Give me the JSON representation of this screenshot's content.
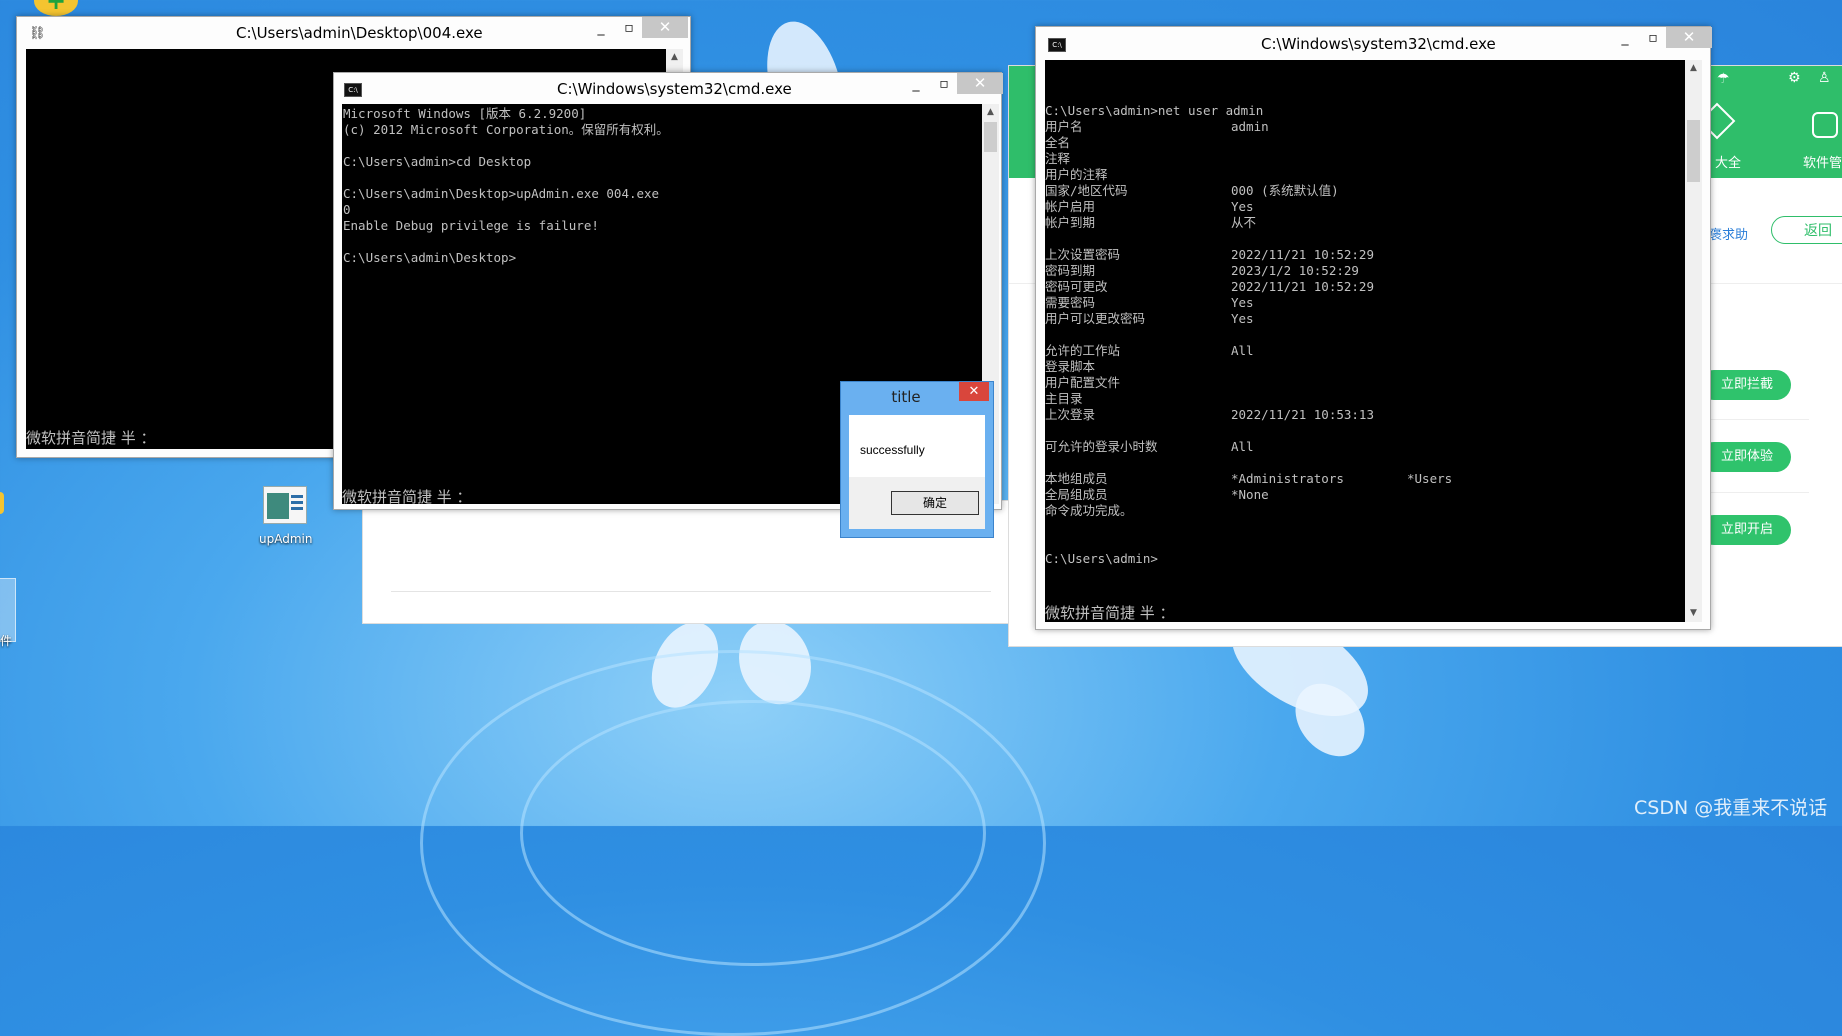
{
  "desktop": {
    "icon_label": "upAdmin",
    "left_edge_label": "件",
    "watermark": "CSDN @我重来不说话"
  },
  "win_004": {
    "title": "C:\\Users\\admin\\Desktop\\004.exe",
    "ime": "微软拼音简捷 半 ："
  },
  "cmd_middle": {
    "title": "C:\\Windows\\system32\\cmd.exe",
    "lines": [
      "Microsoft Windows [版本 6.2.9200]",
      "(c) 2012 Microsoft Corporation。保留所有权利。",
      "",
      "C:\\Users\\admin>cd Desktop",
      "",
      "C:\\Users\\admin\\Desktop>upAdmin.exe 004.exe",
      "0",
      "Enable Debug privilege is failure!",
      "",
      "C:\\Users\\admin\\Desktop>"
    ],
    "ime": "微软拼音简捷 半 ："
  },
  "cmd_right": {
    "title": "C:\\Windows\\system32\\cmd.exe",
    "lines": [
      {
        "key": "C:\\Users\\admin>net user admin",
        "val": "",
        "val2": ""
      },
      {
        "key": "用户名",
        "val": "admin",
        "val2": ""
      },
      {
        "key": "全名",
        "val": "",
        "val2": ""
      },
      {
        "key": "注释",
        "val": "",
        "val2": ""
      },
      {
        "key": "用户的注释",
        "val": "",
        "val2": ""
      },
      {
        "key": "国家/地区代码",
        "val": "000 (系统默认值)",
        "val2": ""
      },
      {
        "key": "帐户启用",
        "val": "Yes",
        "val2": ""
      },
      {
        "key": "帐户到期",
        "val": "从不",
        "val2": ""
      },
      {
        "key": "",
        "val": "",
        "val2": ""
      },
      {
        "key": "上次设置密码",
        "val": "2022/11/21 10:52:29",
        "val2": ""
      },
      {
        "key": "密码到期",
        "val": "2023/1/2 10:52:29",
        "val2": ""
      },
      {
        "key": "密码可更改",
        "val": "2022/11/21 10:52:29",
        "val2": ""
      },
      {
        "key": "需要密码",
        "val": "Yes",
        "val2": ""
      },
      {
        "key": "用户可以更改密码",
        "val": "Yes",
        "val2": ""
      },
      {
        "key": "",
        "val": "",
        "val2": ""
      },
      {
        "key": "允许的工作站",
        "val": "All",
        "val2": ""
      },
      {
        "key": "登录脚本",
        "val": "",
        "val2": ""
      },
      {
        "key": "用户配置文件",
        "val": "",
        "val2": ""
      },
      {
        "key": "主目录",
        "val": "",
        "val2": ""
      },
      {
        "key": "上次登录",
        "val": "2022/11/21 10:53:13",
        "val2": ""
      },
      {
        "key": "",
        "val": "",
        "val2": ""
      },
      {
        "key": "可允许的登录小时数",
        "val": "All",
        "val2": ""
      },
      {
        "key": "",
        "val": "",
        "val2": ""
      },
      {
        "key": "本地组成员",
        "val": "*Administrators",
        "val2": "*Users"
      },
      {
        "key": "全局组成员",
        "val": "*None",
        "val2": ""
      },
      {
        "key": "命令成功完成。",
        "val": "",
        "val2": ""
      },
      {
        "key": "",
        "val": "",
        "val2": ""
      },
      {
        "key": "",
        "val": "",
        "val2": ""
      },
      {
        "key": "C:\\Users\\admin>",
        "val": "",
        "val2": ""
      }
    ],
    "ime": "微软拼音简捷 半 ："
  },
  "msgbox": {
    "title": "title",
    "text": "successfully",
    "ok": "确定"
  },
  "greenapp": {
    "tab1": "大全",
    "tab2": "软件管",
    "help": "褒求助",
    "back": "返回",
    "btn1": "立即拦截",
    "btn2": "立即体验",
    "btn3": "立即开启"
  },
  "colors": {
    "console_text": "#c0c0c0",
    "console_bg": "#000000",
    "app_green": "#2fbe6a",
    "msgbox_frame": "#6ab0f0"
  }
}
